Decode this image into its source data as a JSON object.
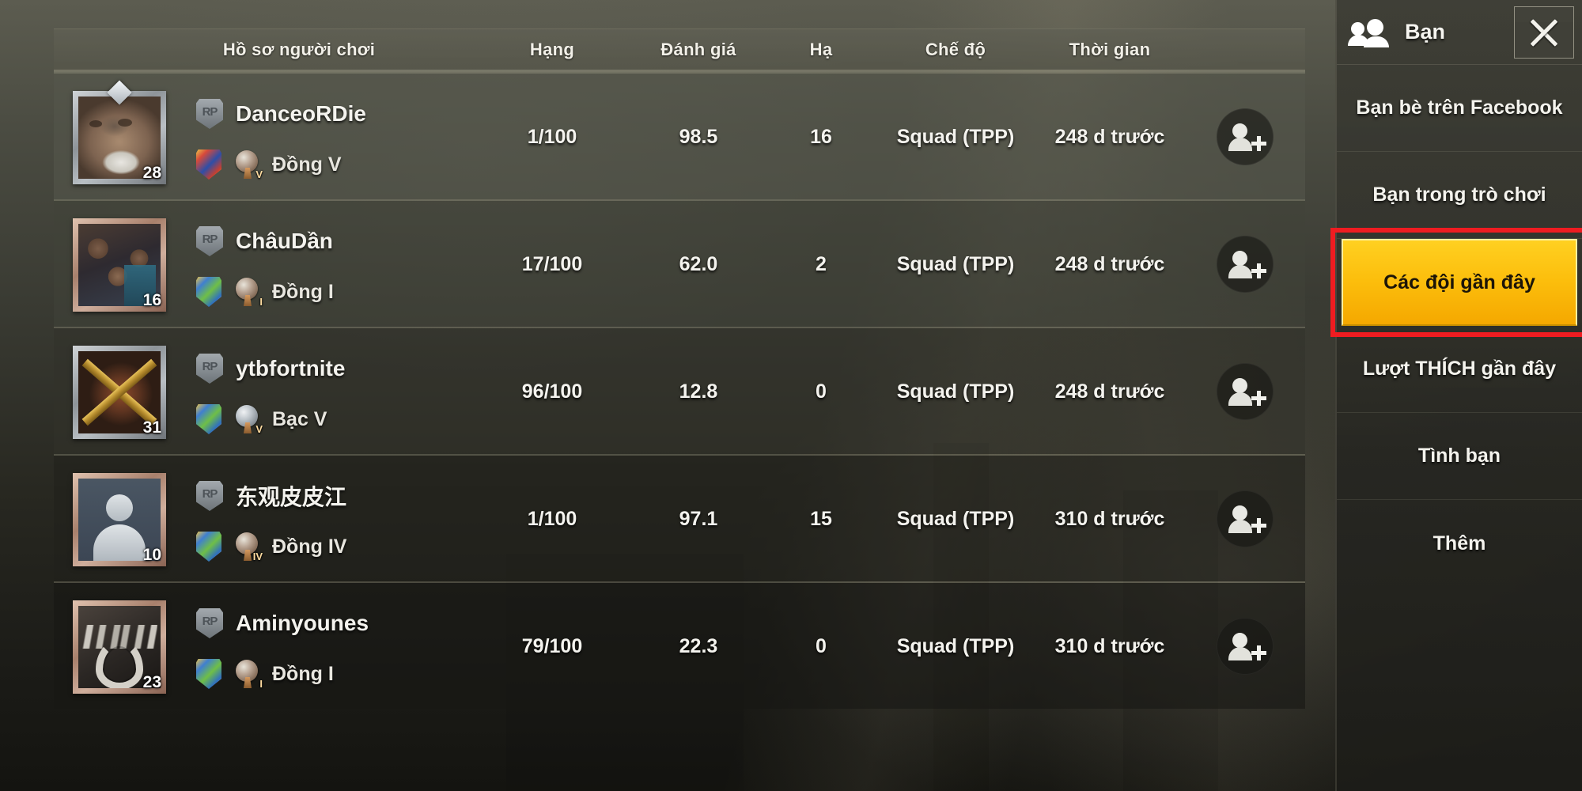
{
  "table": {
    "headers": [
      {
        "key": "profile",
        "label": "Hồ sơ người chơi"
      },
      {
        "key": "rank",
        "label": "Hạng"
      },
      {
        "key": "rating",
        "label": "Đánh giá"
      },
      {
        "key": "kills",
        "label": "Hạ"
      },
      {
        "key": "mode",
        "label": "Chế độ"
      },
      {
        "key": "time",
        "label": "Thời gian"
      }
    ],
    "rows": [
      {
        "name": "DanceoRDie",
        "level": "28",
        "tier": "Đồng V",
        "tier_roman": "V",
        "rank": "1/100",
        "rating": "98.5",
        "kills": "16",
        "mode": "Squad (TPP)",
        "time": "248 d trước",
        "rp_badge": "RP",
        "avatar_art": "art-oldman",
        "frame": "silver",
        "medal": "bronze",
        "clan": "c-red",
        "add_friend_label": "Thêm bạn"
      },
      {
        "name": "ChâuDần",
        "level": "16",
        "tier": "Đồng I",
        "tier_roman": "I",
        "rank": "17/100",
        "rating": "62.0",
        "kills": "2",
        "mode": "Squad (TPP)",
        "time": "248 d trước",
        "rp_badge": "RP",
        "avatar_art": "art-family",
        "frame": "bronze",
        "medal": "bronze",
        "clan": "c-green",
        "add_friend_label": "Thêm bạn"
      },
      {
        "name": "ytbfortnite",
        "level": "31",
        "tier": "Bạc V",
        "tier_roman": "V",
        "rank": "96/100",
        "rating": "12.8",
        "kills": "0",
        "mode": "Squad (TPP)",
        "time": "248 d trước",
        "rp_badge": "RP",
        "avatar_art": "art-crossguns",
        "frame": "silver",
        "medal": "silver",
        "clan": "c-green",
        "add_friend_label": "Thêm bạn"
      },
      {
        "name": "东观皮皮江",
        "level": "10",
        "tier": "Đồng IV",
        "tier_roman": "IV",
        "rank": "1/100",
        "rating": "97.1",
        "kills": "15",
        "mode": "Squad (TPP)",
        "time": "310 d trước",
        "rp_badge": "RP",
        "avatar_art": "art-default",
        "frame": "bronze",
        "medal": "bronze",
        "clan": "c-green",
        "add_friend_label": "Thêm bạn"
      },
      {
        "name": "Aminyounes",
        "level": "23",
        "tier": "Đồng I",
        "tier_roman": "I",
        "rank": "79/100",
        "rating": "22.3",
        "kills": "0",
        "mode": "Squad (TPP)",
        "time": "310 d trước",
        "rp_badge": "RP",
        "avatar_art": "art-wings",
        "frame": "bronze",
        "medal": "bronze",
        "clan": "c-green",
        "add_friend_label": "Thêm bạn"
      }
    ]
  },
  "panel": {
    "title": "Bạn",
    "friends_icon": "friends-icon",
    "close_icon": "close-icon",
    "items": [
      {
        "label": "Bạn bè trên Facebook",
        "active": false
      },
      {
        "label": "Bạn trong trò chơi",
        "active": false
      },
      {
        "label": "Các đội gần đây",
        "active": true
      },
      {
        "label": "Lượt THÍCH gần đây",
        "active": false
      },
      {
        "label": "Tình bạn",
        "active": false
      },
      {
        "label": "Thêm",
        "active": false
      }
    ]
  },
  "colors": {
    "accent_yellow": "#fcbe0c",
    "highlight_red": "#ef1c21",
    "text_light": "#f4f3ee",
    "panel_bg": "#343430"
  }
}
